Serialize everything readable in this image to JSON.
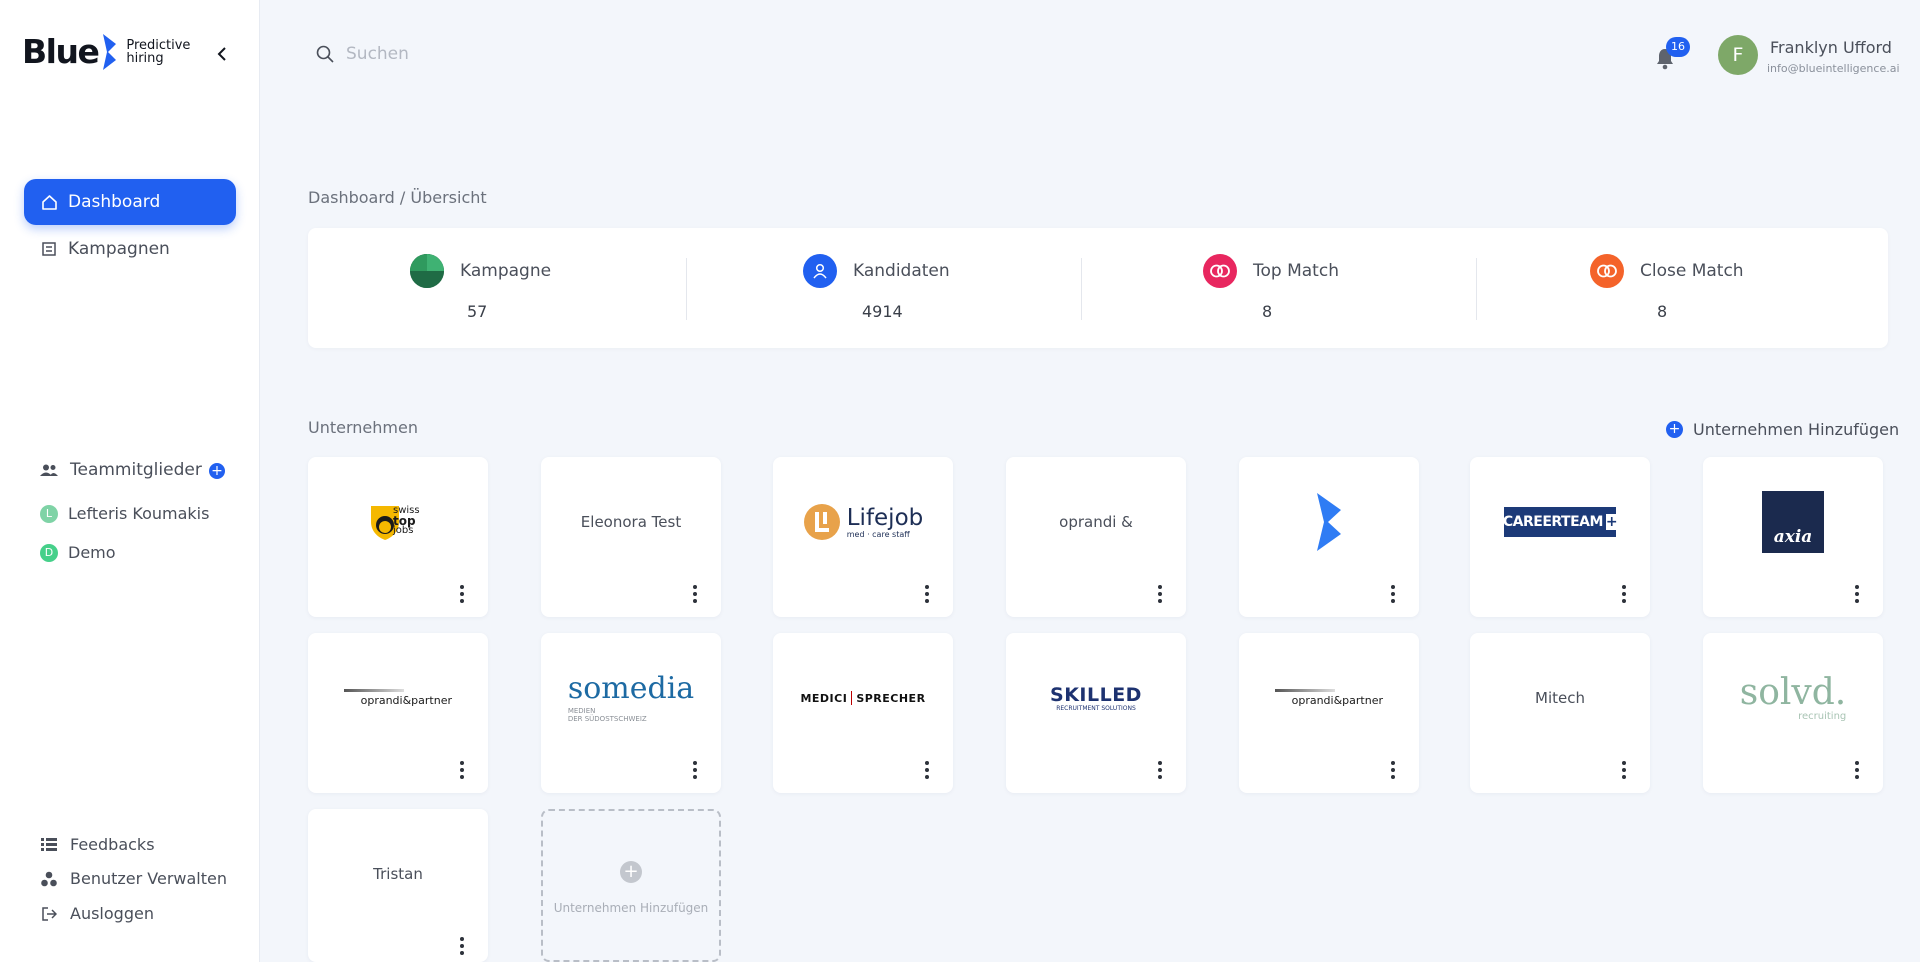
{
  "brand": {
    "name": "Blue",
    "tagline_line1": "Predictive",
    "tagline_line2": "hiring",
    "accent": "#2160f0"
  },
  "sidebar": {
    "nav": [
      {
        "label": "Dashboard",
        "icon": "home-icon",
        "active": true
      },
      {
        "label": "Kampagnen",
        "icon": "campaign-icon",
        "active": false
      }
    ],
    "team": {
      "label": "Teammitglieder",
      "members": [
        {
          "initial": "L",
          "name": "Lefteris Koumakis",
          "color": "#7fd3a6"
        },
        {
          "initial": "D",
          "name": "Demo",
          "color": "#46d08a"
        }
      ]
    },
    "bottom": [
      {
        "label": "Feedbacks",
        "icon": "list-icon"
      },
      {
        "label": "Benutzer Verwalten",
        "icon": "users-icon"
      },
      {
        "label": "Ausloggen",
        "icon": "logout-icon"
      }
    ]
  },
  "header": {
    "search_placeholder": "Suchen",
    "notifications": "16",
    "user": {
      "initial": "F",
      "name": "Franklyn Ufford",
      "email": "info@blueintelligence.ai"
    }
  },
  "breadcrumb": "Dashboard / Übersicht",
  "stats": [
    {
      "label": "Kampagne",
      "value": "57",
      "color": "#2e7d4f"
    },
    {
      "label": "Kandidaten",
      "value": "4914",
      "color": "#2160f0"
    },
    {
      "label": "Top Match",
      "value": "8",
      "color": "#e8275f"
    },
    {
      "label": "Close Match",
      "value": "8",
      "color": "#f4632a"
    }
  ],
  "companies": {
    "title": "Unternehmen",
    "add_label": "Unternehmen Hinzufügen",
    "items": [
      {
        "type": "logo",
        "logo": "swiss-top-jobs",
        "lines": [
          "swiss",
          "top",
          "jobs"
        ]
      },
      {
        "type": "text",
        "name": "Eleonora Test"
      },
      {
        "type": "logo",
        "logo": "lifejob",
        "lines": [
          "Lifejob",
          "med · care staff"
        ]
      },
      {
        "type": "text",
        "name": "oprandi &"
      },
      {
        "type": "logo",
        "logo": "blue-mark",
        "lines": []
      },
      {
        "type": "logo",
        "logo": "careerteam",
        "lines": [
          "CAREERTEAM"
        ]
      },
      {
        "type": "logo",
        "logo": "axia",
        "lines": [
          "axia"
        ]
      },
      {
        "type": "logo",
        "logo": "oprandi-partner",
        "lines": [
          "oprandi&partner"
        ]
      },
      {
        "type": "logo",
        "logo": "somedia",
        "lines": [
          "somedia",
          "MEDIEN",
          "DER SÜDOSTSCHWEIZ"
        ]
      },
      {
        "type": "logo",
        "logo": "medici-sprecher",
        "lines": [
          "MEDICI",
          "SPRECHER"
        ]
      },
      {
        "type": "logo",
        "logo": "skilled",
        "lines": [
          "SKILLED",
          "RECRUITMENT SOLUTIONS"
        ]
      },
      {
        "type": "logo",
        "logo": "oprandi-partner",
        "lines": [
          "oprandi&partner"
        ]
      },
      {
        "type": "text",
        "name": "Mitech"
      },
      {
        "type": "logo",
        "logo": "solvd",
        "lines": [
          "solvd.",
          "recruiting"
        ]
      },
      {
        "type": "text",
        "name": "Tristan"
      }
    ]
  }
}
